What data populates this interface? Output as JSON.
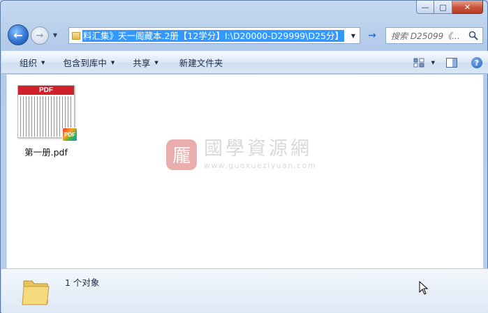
{
  "window": {
    "caption_buttons": {
      "minimize": "—",
      "maximize": "□",
      "close": "✕"
    }
  },
  "nav": {
    "back_glyph": "←",
    "forward_glyph": "→",
    "history_glyph": "▼",
    "address_path": "料汇集》天一阁藏本.2册【12学分】I:\\D20000-D29999\\D25分】",
    "address_dropdown_glyph": "▼",
    "go_glyph": "→",
    "search_placeholder": "搜索 D25099《..."
  },
  "toolbar": {
    "organize": "组织",
    "include_in_library": "包含到库中",
    "share": "共享",
    "new_folder": "新建文件夹",
    "caret": "▼",
    "view_caret": "▼",
    "help": "?"
  },
  "files": [
    {
      "name": "第一册.pdf",
      "thumb_header": "PDF",
      "badge": "PDF"
    }
  ],
  "watermark": {
    "seal": "龎",
    "title": "國學資源網",
    "url": "www.guoxueziyuan.com"
  },
  "status": {
    "count_text": "1 个对象"
  },
  "colors": {
    "selection": "#3399ff",
    "close_button": "#c8513a",
    "pdf_header": "#d0202a"
  }
}
